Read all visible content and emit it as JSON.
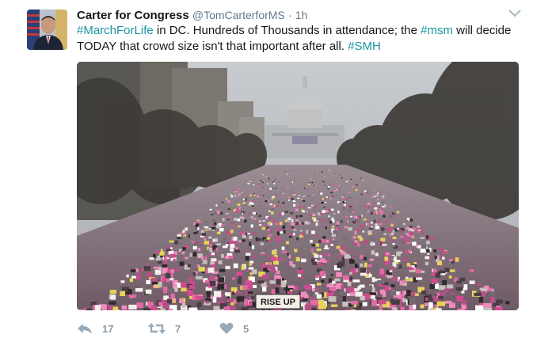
{
  "tweet": {
    "author_name": "Carter for Congress",
    "handle": "@TomCarterforMS",
    "separator": "·",
    "time": "1h",
    "text_parts": [
      {
        "text": "#MarchForLife",
        "type": "hashtag"
      },
      {
        "text": " in DC. Hundreds of Thousands in attendance; the ",
        "type": "plain"
      },
      {
        "text": "#msm",
        "type": "hashtag"
      },
      {
        "text": " will decide TODAY that crowd size isn't that important after all. ",
        "type": "plain"
      },
      {
        "text": "#SMH",
        "type": "hashtag"
      }
    ],
    "media": {
      "sign_text": "RISE UP"
    },
    "actions": {
      "reply_count": "17",
      "retweet_count": "7",
      "like_count": "5"
    }
  },
  "colors": {
    "hashtag": "#1b95a0",
    "meta": "#657786",
    "action_icon": "#9aa9b6"
  },
  "icons": {
    "reply": "reply-icon",
    "retweet": "retweet-icon",
    "like": "heart-icon",
    "caret": "chevron-down-icon"
  }
}
